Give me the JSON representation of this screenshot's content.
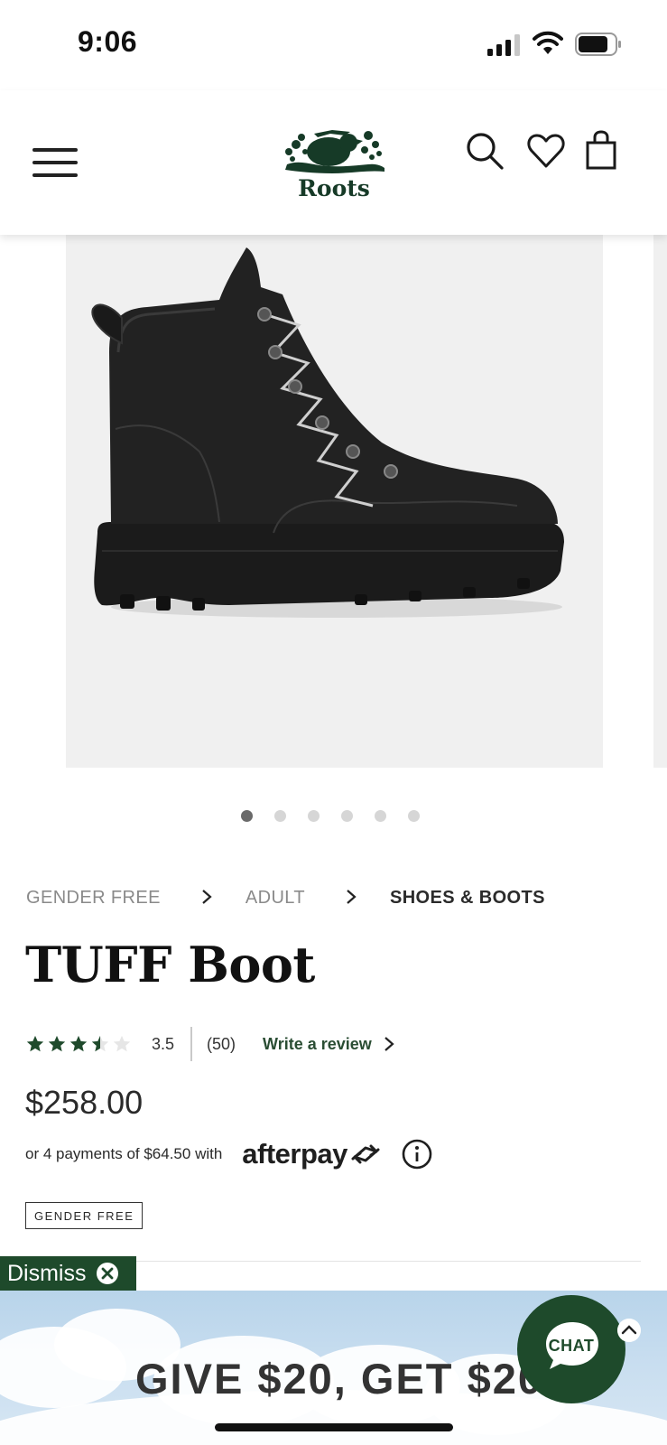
{
  "status_bar": {
    "time": "9:06"
  },
  "header": {
    "logo_text": "Roots"
  },
  "gallery": {
    "image_count": 6,
    "active_index": 0
  },
  "breadcrumb": [
    {
      "label": "GENDER FREE"
    },
    {
      "label": "ADULT"
    },
    {
      "label": "SHOES & BOOTS"
    }
  ],
  "product": {
    "title": "TUFF Boot",
    "rating": "3.5",
    "rating_value": 3.5,
    "review_count": "(50)",
    "write_review": "Write a review",
    "price": "$258.00",
    "installments": "or 4 payments of $64.50 with",
    "afterpay": "afterpay",
    "badge": "GENDER FREE"
  },
  "promo": {
    "dismiss": "Dismiss",
    "headline": "GIVE $20, GET $20",
    "chat": "CHAT"
  },
  "colors": {
    "brand_green": "#1e4a2b",
    "star_green": "#1f4a2c"
  }
}
